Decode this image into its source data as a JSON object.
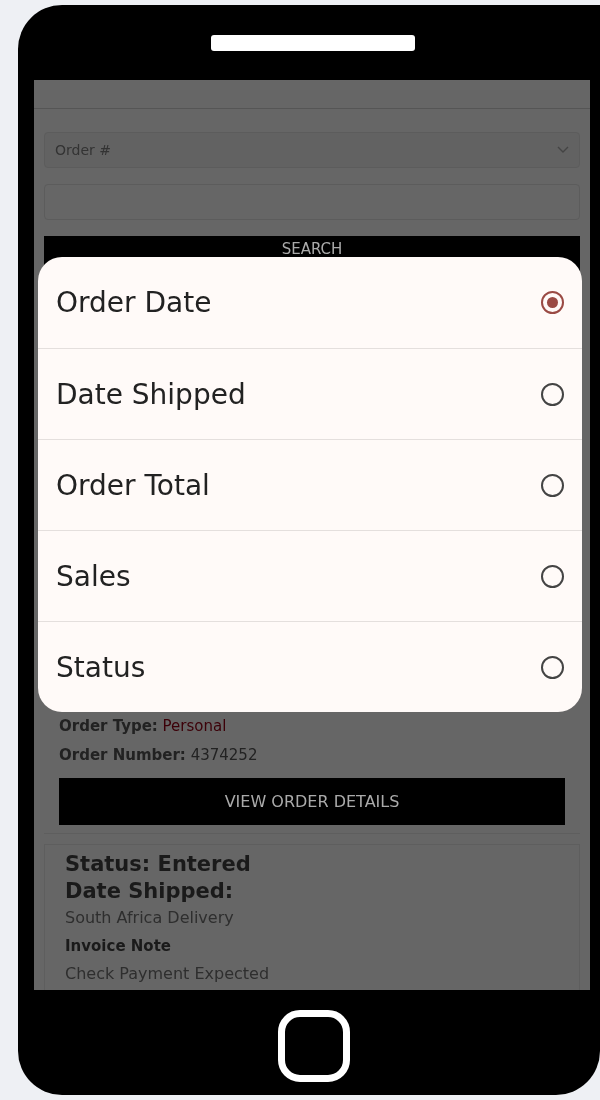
{
  "search": {
    "field": "Order #",
    "button": "SEARCH"
  },
  "sort_dialog": {
    "options": [
      {
        "label": "Order Date",
        "selected": true
      },
      {
        "label": "Date Shipped",
        "selected": false
      },
      {
        "label": "Order Total",
        "selected": false
      },
      {
        "label": "Sales",
        "selected": false
      },
      {
        "label": "Status",
        "selected": false
      }
    ]
  },
  "order": {
    "type_label": "Order Type:",
    "type": "Personal",
    "number_label": "Order Number:",
    "number": "4374252",
    "button": "VIEW ORDER DETAILS"
  },
  "shipment": {
    "status": "Status: Entered",
    "date_shipped": "Date Shipped:",
    "method": "South Africa Delivery",
    "note_label": "Invoice Note",
    "note": "Check Payment Expected"
  }
}
